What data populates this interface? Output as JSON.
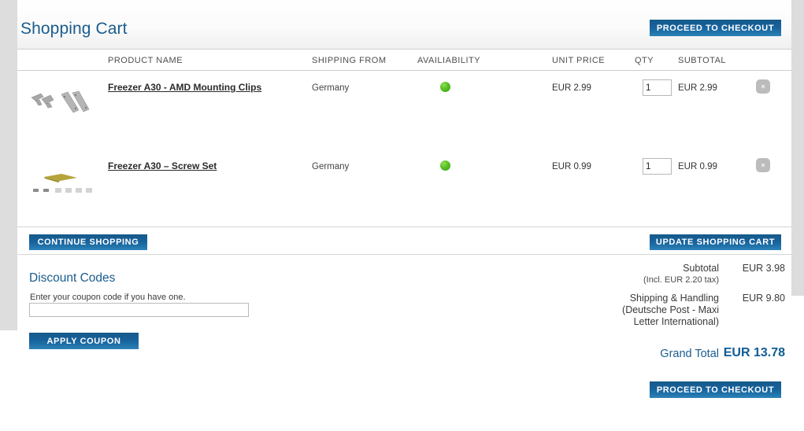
{
  "page": {
    "title": "Shopping Cart"
  },
  "header": {
    "checkout_button": "PROCEED TO CHECKOUT"
  },
  "table": {
    "headers": {
      "product_name": "PRODUCT NAME",
      "shipping_from": "SHIPPING FROM",
      "availability": "AVAILIABILITY",
      "unit_price": "UNIT PRICE",
      "qty": "QTY",
      "subtotal": "SUBTOTAL"
    },
    "rows": [
      {
        "name": "Freezer A30 - AMD Mounting Clips",
        "shipping_from": "Germany",
        "availability": "in-stock",
        "availability_color": "#58c024",
        "unit_price": "EUR 2.99",
        "qty": "1",
        "subtotal": "EUR 2.99",
        "remove_icon": "close-circle-icon",
        "thumb": "mounting-clips-image"
      },
      {
        "name": "Freezer A30 – Screw Set",
        "shipping_from": "Germany",
        "availability": "in-stock",
        "availability_color": "#58c024",
        "unit_price": "EUR 0.99",
        "qty": "1",
        "subtotal": "EUR 0.99",
        "remove_icon": "close-circle-icon",
        "thumb": "screw-set-image"
      }
    ]
  },
  "actions": {
    "continue_shopping": "CONTINUE SHOPPING",
    "update_cart": "UPDATE SHOPPING CART"
  },
  "discount": {
    "title": "Discount Codes",
    "note": "Enter your coupon code if you have one.",
    "input_value": "",
    "input_placeholder": "",
    "apply_button": "APPLY COUPON"
  },
  "totals": {
    "subtotal_label": "Subtotal",
    "subtotal_tax": "(Incl. EUR 2.20 tax)",
    "subtotal_value": "EUR 3.98",
    "shipping_label": "Shipping & Handling",
    "shipping_desc_line1": "(Deutsche Post - Maxi",
    "shipping_desc_line2": "Letter International)",
    "shipping_value": "EUR 9.80",
    "grand_total_label": "Grand Total",
    "grand_total_value": "EUR 13.78"
  },
  "footer": {
    "checkout_button": "PROCEED TO CHECKOUT"
  },
  "colors": {
    "brand_blue": "#1a5c8e",
    "button_blue_dark": "#155a8a",
    "button_blue_light": "#2e83b8",
    "in_stock_green": "#58c024",
    "remove_gray": "#bcbcbc"
  }
}
